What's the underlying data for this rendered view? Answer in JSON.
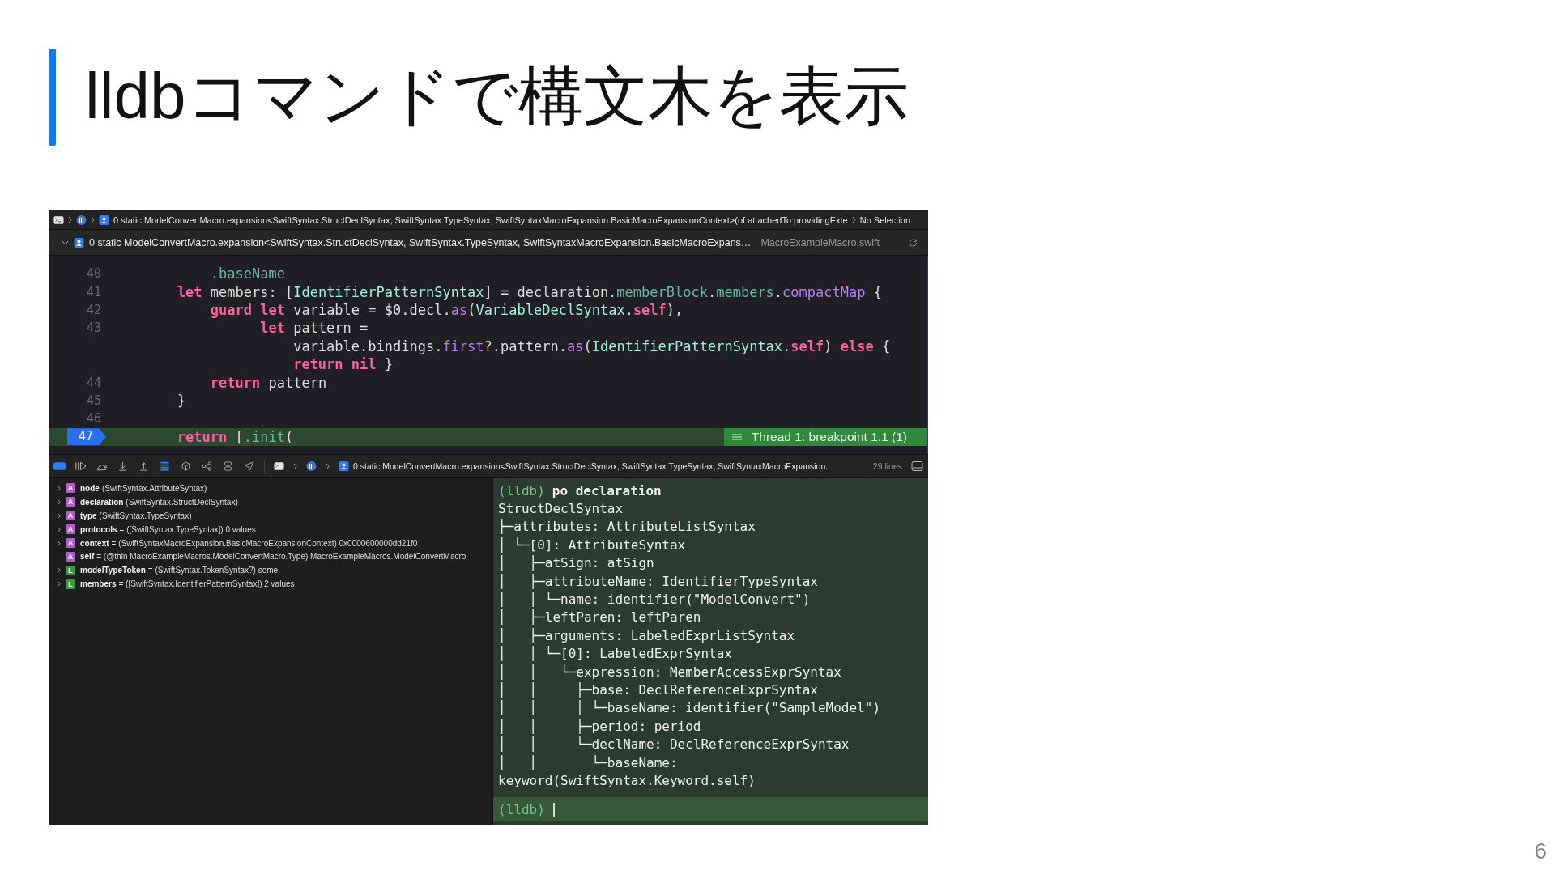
{
  "slide": {
    "title": "lldbコマンドで構文木を表示",
    "page_number": "6"
  },
  "jump_bar": {
    "frame": "0 static ModelConvertMacro.expansion<SwiftSyntax.StructDeclSyntax, SwiftSyntax.TypeSyntax, SwiftSyntaxMacroExpansion.BasicMacroExpansionContext>(of:attachedTo:providingExte",
    "selection": "No Selection"
  },
  "editor_bar": {
    "frame": "0 static ModelConvertMacro.expansion<SwiftSyntax.StructDeclSyntax, SwiftSyntax.TypeSyntax, SwiftSyntaxMacroExpansion.BasicMacroExpans…",
    "file": "MacroExampleMacro.swift"
  },
  "code": {
    "breakpoint_label": "Thread 1: breakpoint 1.1 (1)",
    "lines": [
      {
        "number": "40",
        "current": false,
        "tokens": [
          {
            "kind": "member",
            "text": "            .baseName"
          }
        ]
      },
      {
        "number": "41",
        "current": false,
        "tokens": [
          {
            "kind": "keyword",
            "text": "        let"
          },
          {
            "kind": "plain",
            "text": " members: ["
          },
          {
            "kind": "type",
            "text": "IdentifierPatternSyntax"
          },
          {
            "kind": "plain",
            "text": "] = declaration."
          },
          {
            "kind": "member",
            "text": "memberBlock"
          },
          {
            "kind": "plain",
            "text": "."
          },
          {
            "kind": "member",
            "text": "members"
          },
          {
            "kind": "plain",
            "text": "."
          },
          {
            "kind": "method",
            "text": "compactMap"
          },
          {
            "kind": "plain",
            "text": " {"
          }
        ]
      },
      {
        "number": "42",
        "current": false,
        "tokens": [
          {
            "kind": "keyword",
            "text": "            guard "
          },
          {
            "kind": "keyword",
            "text": "let"
          },
          {
            "kind": "plain",
            "text": " variable = $0.decl."
          },
          {
            "kind": "method",
            "text": "as"
          },
          {
            "kind": "plain",
            "text": "("
          },
          {
            "kind": "type",
            "text": "VariableDeclSyntax"
          },
          {
            "kind": "plain",
            "text": "."
          },
          {
            "kind": "keyword",
            "text": "self"
          },
          {
            "kind": "plain",
            "text": "),"
          }
        ]
      },
      {
        "number": "43",
        "current": false,
        "tokens": [
          {
            "kind": "keyword",
            "text": "                  let"
          },
          {
            "kind": "plain",
            "text": " pattern ="
          }
        ]
      },
      {
        "current": false,
        "tokens": [
          {
            "kind": "plain",
            "text": "                      variable.bindings."
          },
          {
            "kind": "method",
            "text": "first"
          },
          {
            "kind": "plain",
            "text": "?.pattern."
          },
          {
            "kind": "method",
            "text": "as"
          },
          {
            "kind": "plain",
            "text": "("
          },
          {
            "kind": "type",
            "text": "IdentifierPatternSyntax"
          },
          {
            "kind": "plain",
            "text": "."
          },
          {
            "kind": "keyword",
            "text": "self"
          },
          {
            "kind": "plain",
            "text": ") "
          },
          {
            "kind": "keyword",
            "text": "else"
          },
          {
            "kind": "plain",
            "text": " {"
          }
        ]
      },
      {
        "current": false,
        "tokens": [
          {
            "kind": "keyword",
            "text": "                      return "
          },
          {
            "kind": "keyword",
            "text": "nil"
          },
          {
            "kind": "plain",
            "text": " }"
          }
        ]
      },
      {
        "number": "44",
        "current": false,
        "tokens": [
          {
            "kind": "keyword",
            "text": "            return"
          },
          {
            "kind": "plain",
            "text": " pattern"
          }
        ]
      },
      {
        "number": "45",
        "current": false,
        "tokens": [
          {
            "kind": "plain",
            "text": "        }"
          }
        ]
      },
      {
        "number": "46",
        "current": false
      },
      {
        "number": "47",
        "current": true,
        "tokens": [
          {
            "kind": "keyword",
            "text": "        return"
          },
          {
            "kind": "plain",
            "text": " ["
          },
          {
            "kind": "member",
            "text": ".init"
          },
          {
            "kind": "plain",
            "text": "("
          }
        ]
      }
    ]
  },
  "debug_bar": {
    "frame": "0 static ModelConvertMacro.expansion<SwiftSyntax.StructDeclSyntax, SwiftSyntax.TypeSyntax, SwiftSyntaxMacroExpansion.",
    "line_count": "29 lines"
  },
  "variables": [
    {
      "badge": "A",
      "color": "#b45ccc",
      "expandable": true,
      "name": "node",
      "detail": "(SwiftSyntax.AttributeSyntax)"
    },
    {
      "badge": "A",
      "color": "#b45ccc",
      "expandable": true,
      "name": "declaration",
      "detail": "(SwiftSyntax.StructDeclSyntax)"
    },
    {
      "badge": "A",
      "color": "#b45ccc",
      "expandable": true,
      "name": "type",
      "detail": "(SwiftSyntax.TypeSyntax)"
    },
    {
      "badge": "A",
      "color": "#b45ccc",
      "expandable": true,
      "name": "protocols",
      "detail": "= ([SwiftSyntax.TypeSyntax]) 0 values"
    },
    {
      "badge": "A",
      "color": "#b45ccc",
      "expandable": true,
      "name": "context",
      "detail": "= (SwiftSyntaxMacroExpansion.BasicMacroExpansionContext) 0x0000600000dd21f0"
    },
    {
      "badge": "A",
      "color": "#b45ccc",
      "expandable": false,
      "name": "self",
      "detail": "= (@thin MacroExampleMacros.ModelConvertMacro.Type) MacroExampleMacros.ModelConvertMacro"
    },
    {
      "badge": "L",
      "color": "#3c9a45",
      "expandable": true,
      "name": "modelTypeToken",
      "detail": "= (SwiftSyntax.TokenSyntax?) some"
    },
    {
      "badge": "L",
      "color": "#3c9a45",
      "expandable": true,
      "name": "members",
      "detail": "= ([SwiftSyntax.IdentifierPatternSyntax]) 2 values"
    }
  ],
  "console": {
    "command": {
      "prompt": "(lldb)",
      "text": "po declaration"
    },
    "output": [
      "StructDeclSyntax",
      "├─attributes: AttributeListSyntax",
      "│ └─[0]: AttributeSyntax",
      "│   ├─atSign: atSign",
      "│   ├─attributeName: IdentifierTypeSyntax",
      "│   │ └─name: identifier(\"ModelConvert\")",
      "│   ├─leftParen: leftParen",
      "│   ├─arguments: LabeledExprListSyntax",
      "│   │ └─[0]: LabeledExprSyntax",
      "│   │   └─expression: MemberAccessExprSyntax",
      "│   │     ├─base: DeclReferenceExprSyntax",
      "│   │     │ └─baseName: identifier(\"SampleModel\")",
      "│   │     ├─period: period",
      "│   │     └─declName: DeclReferenceExprSyntax",
      "│   │       └─baseName:",
      "keyword(SwiftSyntax.Keyword.self)"
    ],
    "input_prompt": "(lldb)"
  }
}
